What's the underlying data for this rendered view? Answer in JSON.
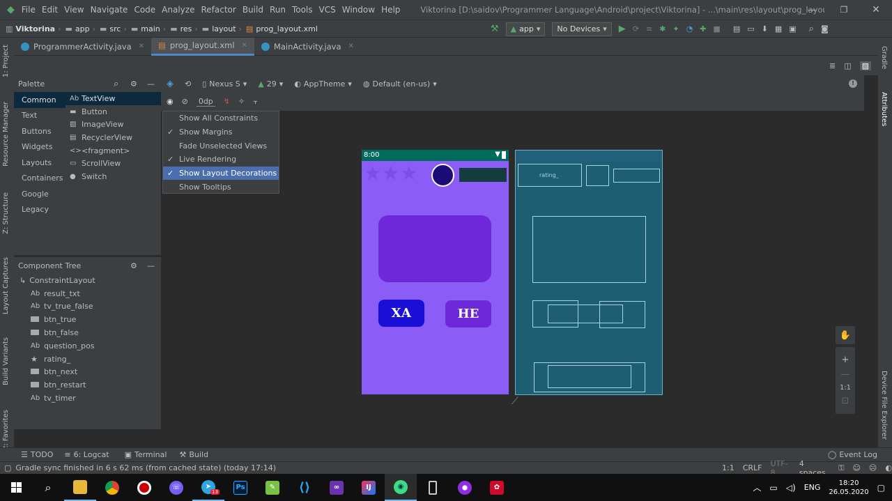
{
  "menu": {
    "items": [
      "File",
      "Edit",
      "View",
      "Navigate",
      "Code",
      "Analyze",
      "Refactor",
      "Build",
      "Run",
      "Tools",
      "VCS",
      "Window",
      "Help"
    ],
    "window_title": "Viktorina [D:\\saidov\\Programmer Language\\Android\\project\\Viktorina] - ...\\main\\res\\layout\\prog_layout.xml [app]"
  },
  "breadcrumbs": [
    "Viktorina",
    "app",
    "src",
    "main",
    "res",
    "layout",
    "prog_layout.xml"
  ],
  "run_config": {
    "module": "app",
    "device": "No Devices"
  },
  "tabs": [
    {
      "label": "ProgrammerActivity.java",
      "active": false
    },
    {
      "label": "prog_layout.xml",
      "active": true
    },
    {
      "label": "MainActivity.java",
      "active": false
    }
  ],
  "left_tools": [
    "1: Project",
    "Resource Manager",
    "Z: Structure",
    "Layout Captures",
    "Build Variants",
    "2: Favorites"
  ],
  "right_tools": [
    "Gradle",
    "Attributes",
    "Device File Explorer"
  ],
  "palette": {
    "title": "Palette",
    "categories": [
      "Common",
      "Text",
      "Buttons",
      "Widgets",
      "Layouts",
      "Containers",
      "Google",
      "Legacy"
    ],
    "components": [
      "TextView",
      "Button",
      "ImageView",
      "RecyclerView",
      "<fragment>",
      "ScrollView",
      "Switch"
    ]
  },
  "design_toolbar": {
    "device": "Nexus S",
    "api": "29",
    "theme": "AppTheme",
    "locale": "Default (en-us)",
    "margin": "0dp"
  },
  "view_options": [
    {
      "label": "Show All Constraints",
      "checked": false
    },
    {
      "label": "Show Margins",
      "checked": true
    },
    {
      "label": "Fade Unselected Views",
      "checked": false
    },
    {
      "label": "Live Rendering",
      "checked": true
    },
    {
      "label": "Show Layout Decorations",
      "checked": true
    },
    {
      "label": "Show Tooltips",
      "checked": false
    }
  ],
  "component_tree": {
    "title": "Component Tree",
    "root": "ConstraintLayout",
    "children": [
      {
        "type": "text",
        "label": "result_txt"
      },
      {
        "type": "text",
        "label": "tv_true_false"
      },
      {
        "type": "button",
        "label": "btn_true"
      },
      {
        "type": "button",
        "label": "btn_false"
      },
      {
        "type": "text",
        "label": "question_pos"
      },
      {
        "type": "rating",
        "label": "rating_"
      },
      {
        "type": "button",
        "label": "btn_next"
      },
      {
        "type": "button",
        "label": "btn_restart"
      },
      {
        "type": "text",
        "label": "tv_timer"
      }
    ]
  },
  "phone": {
    "time": "8:00",
    "btn_true": "ХА",
    "btn_false": "НЕ",
    "stars": 3
  },
  "blueprint": {
    "rating_label": "rating_"
  },
  "zoom": {
    "fit": "1:1"
  },
  "bottom_tools": [
    "TODO",
    "6: Logcat",
    "Terminal",
    "Build"
  ],
  "event_log": "Event Log",
  "status": {
    "message": "Gradle sync finished in 6 s 62 ms (from cached state) (today 17:14)",
    "position": "1:1",
    "line_sep": "CRLF",
    "encoding": "UTF-8",
    "indent": "4 spaces"
  },
  "taskbar": {
    "lang": "ENG",
    "time": "18:20",
    "date": "26.05.2020",
    "telegram_badge": "13"
  },
  "colors": {
    "accent": "#4a88c7",
    "phone_bg": "#8b5cf6",
    "blueprint": "#1e5e73"
  }
}
